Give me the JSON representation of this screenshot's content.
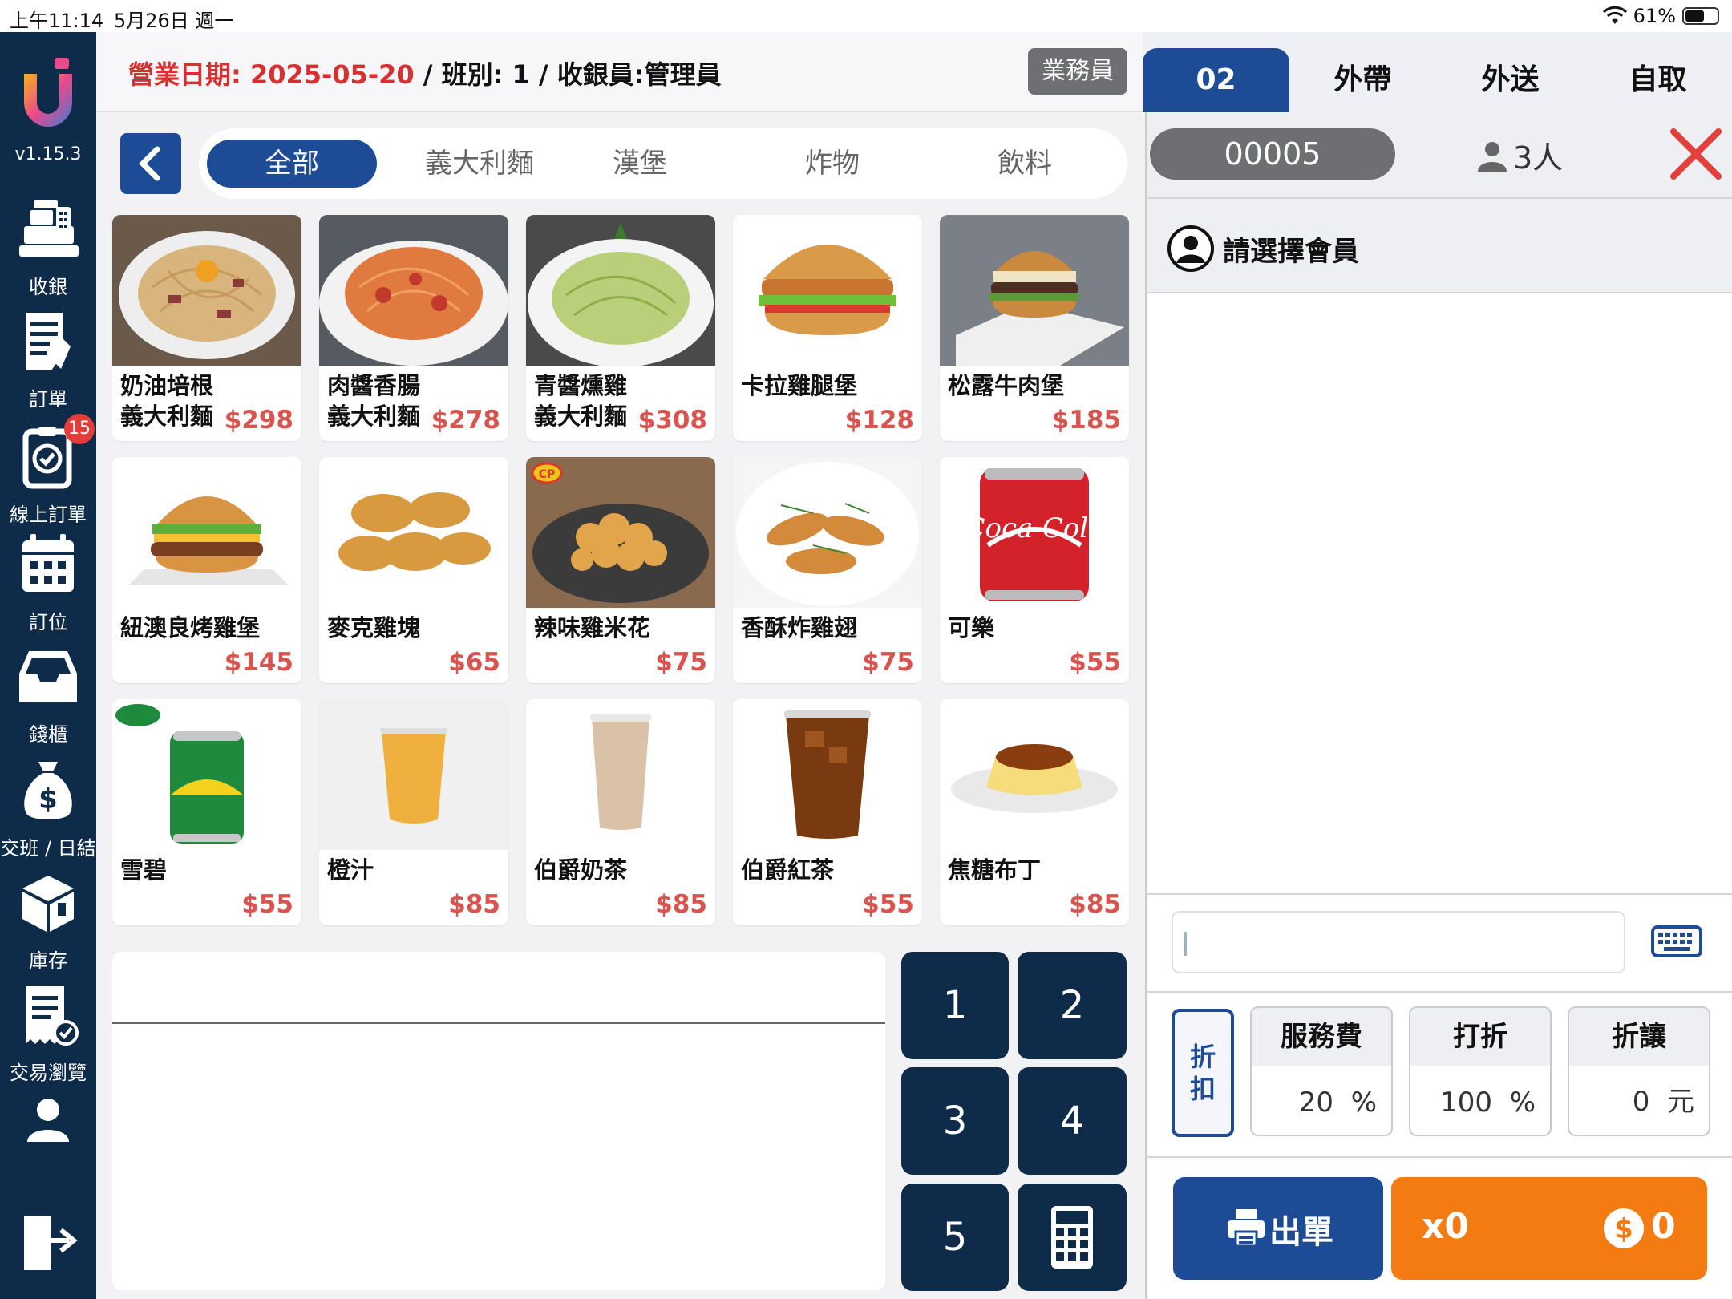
{
  "status": {
    "time": "上午11:14",
    "date": "5月26日 週一",
    "battery": "61%",
    "battery_level": 0.61
  },
  "app": {
    "version": "v1.15.3"
  },
  "sidebar": {
    "items": [
      {
        "label": "收銀",
        "icon": "cash-register-icon"
      },
      {
        "label": "訂單",
        "icon": "order-list-icon"
      },
      {
        "label": "線上訂單",
        "icon": "online-order-icon",
        "badge": "15"
      },
      {
        "label": "訂位",
        "icon": "calendar-icon"
      },
      {
        "label": "錢櫃",
        "icon": "cash-drawer-icon"
      },
      {
        "label": "交班 / 日結",
        "icon": "money-bag-icon"
      },
      {
        "label": "庫存",
        "icon": "inventory-box-icon"
      },
      {
        "label": "交易瀏覽",
        "icon": "transaction-receipt-icon"
      },
      {
        "label": "",
        "icon": "user-icon"
      },
      {
        "label": "",
        "icon": "logout-icon"
      }
    ]
  },
  "header": {
    "business_date": "營業日期: 2025-05-20",
    "rest": " / 班別: 1 / 收銀員:管理員",
    "staff_button": "業務員"
  },
  "categories": {
    "active": "全部",
    "items": [
      "全部",
      "義大利麵",
      "漢堡",
      "炸物",
      "飲料"
    ]
  },
  "products": [
    {
      "name": "奶油培根\n義大利麵",
      "price": "$298"
    },
    {
      "name": "肉醬香腸\n義大利麵",
      "price": "$278"
    },
    {
      "name": "青醬燻雞\n義大利麵",
      "price": "$308"
    },
    {
      "name": "卡拉雞腿堡",
      "price": "$128"
    },
    {
      "name": "松露牛肉堡",
      "price": "$185"
    },
    {
      "name": "紐澳良烤雞堡",
      "price": "$145"
    },
    {
      "name": "麥克雞塊",
      "price": "$65"
    },
    {
      "name": "辣味雞米花",
      "price": "$75"
    },
    {
      "name": "香酥炸雞翅",
      "price": "$75"
    },
    {
      "name": "可樂",
      "price": "$55"
    },
    {
      "name": "雪碧",
      "price": "$55"
    },
    {
      "name": "橙汁",
      "price": "$85"
    },
    {
      "name": "伯爵奶茶",
      "price": "$85"
    },
    {
      "name": "伯爵紅茶",
      "price": "$55"
    },
    {
      "name": "焦糖布丁",
      "price": "$85"
    }
  ],
  "keypad": {
    "keys": [
      "1",
      "2",
      "3",
      "4",
      "5"
    ],
    "calculator_icon": "calculator-icon"
  },
  "order_panel": {
    "tabs": [
      "02",
      "外帶",
      "外送",
      "自取"
    ],
    "active_tab": "02",
    "order_number": "00005",
    "guests": "3人",
    "member_prompt": "請選擇會員",
    "input_value": "",
    "discount_tab": "折\n扣",
    "service_fee": {
      "label": "服務費",
      "value": "20",
      "unit": "%"
    },
    "discount": {
      "label": "打折",
      "value": "100",
      "unit": "%"
    },
    "allowance": {
      "label": "折讓",
      "value": "0",
      "unit": "元"
    },
    "print_button": "出單",
    "pay_count": "x0",
    "pay_total": "0"
  },
  "colors": {
    "navy": "#0f2b4a",
    "blue": "#1e4b95",
    "orange": "#f47a12",
    "red_price": "#d9534f",
    "red_date": "#d63030"
  }
}
